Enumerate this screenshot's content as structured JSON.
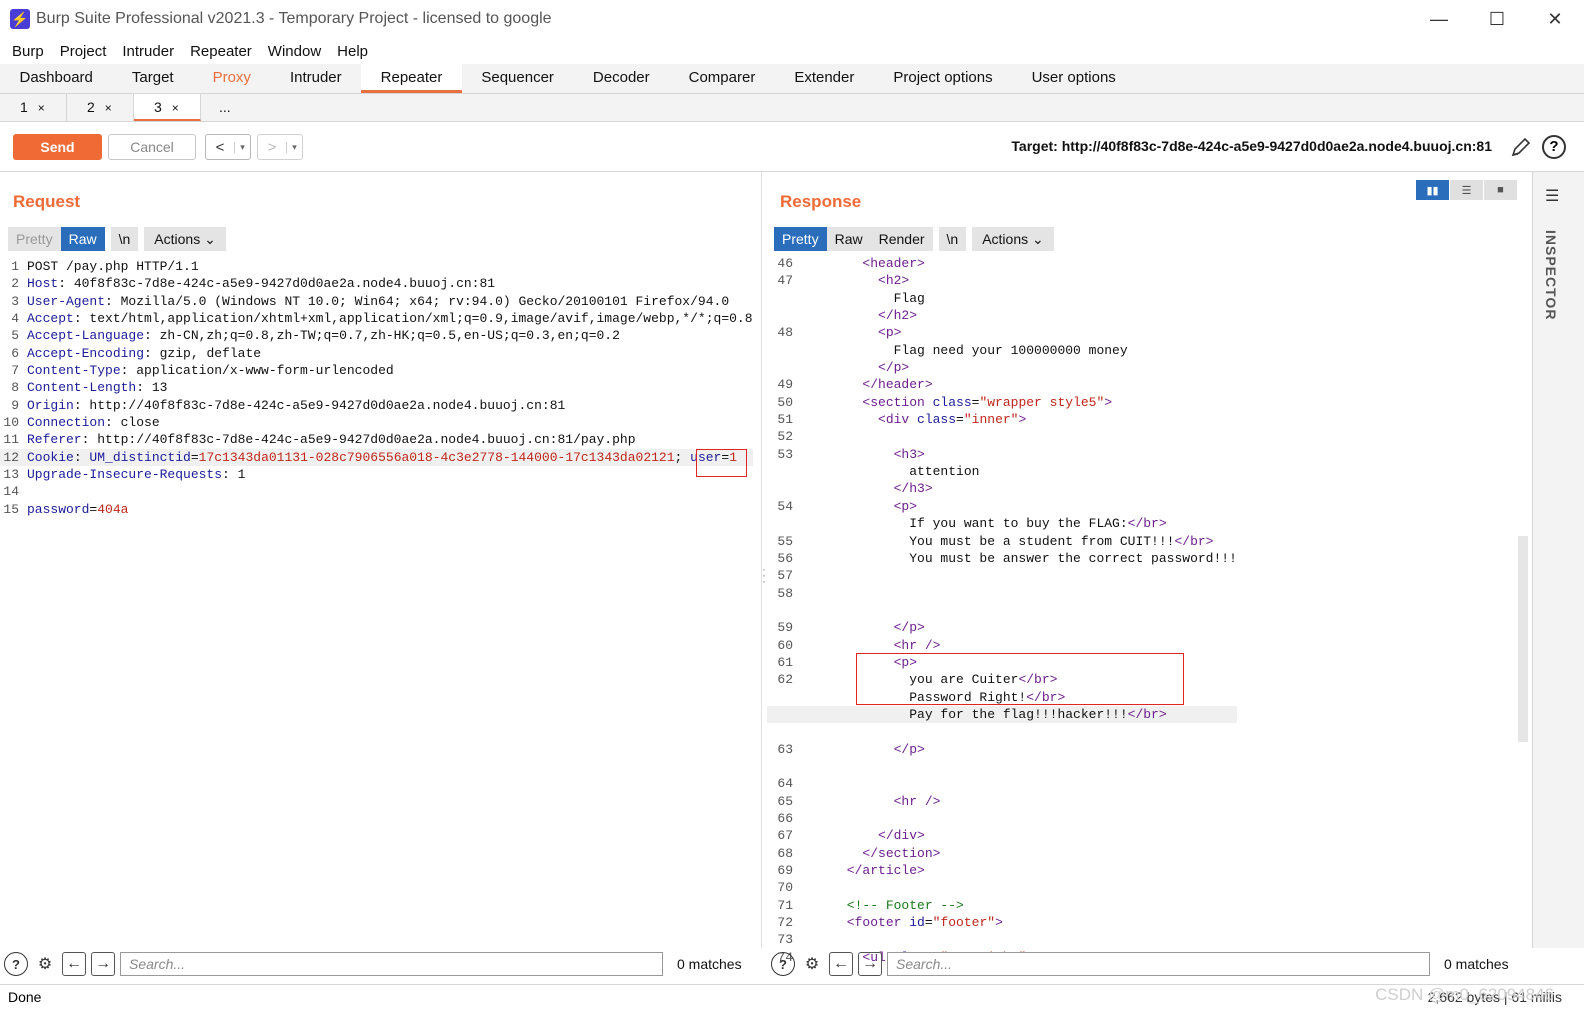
{
  "window": {
    "title": "Burp Suite Professional v2021.3 - Temporary Project - licensed to google",
    "minimize": "—",
    "maximize": "☐",
    "close": "✕"
  },
  "menu": [
    "Burp",
    "Project",
    "Intruder",
    "Repeater",
    "Window",
    "Help"
  ],
  "main_tabs": [
    "Dashboard",
    "Target",
    "Proxy",
    "Intruder",
    "Repeater",
    "Sequencer",
    "Decoder",
    "Comparer",
    "Extender",
    "Project options",
    "User options"
  ],
  "sub_tabs": [
    {
      "label": "1",
      "close": "×"
    },
    {
      "label": "2",
      "close": "×"
    },
    {
      "label": "3",
      "close": "×"
    },
    {
      "label": "..."
    }
  ],
  "toolbar": {
    "send": "Send",
    "cancel": "Cancel",
    "back": "<",
    "forward": ">",
    "dropdown": "▾",
    "target": "Target: http://40f8f83c-7d8e-424c-a5e9-9427d0d0ae2a.node4.buuoj.cn:81",
    "help": "?"
  },
  "request": {
    "title": "Request",
    "views": [
      "Pretty",
      "Raw",
      "\\n"
    ],
    "actions": "Actions",
    "search_placeholder": "Search...",
    "matches": "0 matches"
  },
  "response": {
    "title": "Response",
    "views": [
      "Pretty",
      "Raw",
      "Render",
      "\\n"
    ],
    "actions": "Actions",
    "search_placeholder": "Search...",
    "matches": "0 matches"
  },
  "inspector": {
    "label": "INSPECTOR"
  },
  "status": {
    "left": "Done",
    "right": "2,662 bytes | 61 millis",
    "watermark": "CSDN @m0_62094846"
  },
  "request_lines": [
    {
      "n": "1",
      "parts": [
        {
          "t": "POST /pay.php HTTP/1.1",
          "c": "hv"
        }
      ]
    },
    {
      "n": "2",
      "parts": [
        {
          "t": "Host",
          "c": "hk"
        },
        {
          "t": ": 40f8f83c-7d8e-424c-a5e9-9427d0d0ae2a.node4.buuoj.cn:81",
          "c": "hv"
        }
      ]
    },
    {
      "n": "3",
      "parts": [
        {
          "t": "User-Agent",
          "c": "hk"
        },
        {
          "t": ": Mozilla/5.0 (Windows NT 10.0; Win64; x64; rv:94.0) Gecko/20100101 Firefox/94.0",
          "c": "hv"
        }
      ]
    },
    {
      "n": "4",
      "parts": [
        {
          "t": "Accept",
          "c": "hk"
        },
        {
          "t": ": text/html,application/xhtml+xml,application/xml;q=0.9,image/avif,image/webp,*/*;q=0.8",
          "c": "hv"
        }
      ]
    },
    {
      "n": "5",
      "parts": [
        {
          "t": "Accept-Language",
          "c": "hk"
        },
        {
          "t": ": zh-CN,zh;q=0.8,zh-TW;q=0.7,zh-HK;q=0.5,en-US;q=0.3,en;q=0.2",
          "c": "hv"
        }
      ]
    },
    {
      "n": "6",
      "parts": [
        {
          "t": "Accept-Encoding",
          "c": "hk"
        },
        {
          "t": ": gzip, deflate",
          "c": "hv"
        }
      ]
    },
    {
      "n": "7",
      "parts": [
        {
          "t": "Content-Type",
          "c": "hk"
        },
        {
          "t": ": application/x-www-form-urlencoded",
          "c": "hv"
        }
      ]
    },
    {
      "n": "8",
      "parts": [
        {
          "t": "Content-Length",
          "c": "hk"
        },
        {
          "t": ": 13",
          "c": "hv"
        }
      ]
    },
    {
      "n": "9",
      "parts": [
        {
          "t": "Origin",
          "c": "hk"
        },
        {
          "t": ": http://40f8f83c-7d8e-424c-a5e9-9427d0d0ae2a.node4.buuoj.cn:81",
          "c": "hv"
        }
      ]
    },
    {
      "n": "10",
      "parts": [
        {
          "t": "Connection",
          "c": "hk"
        },
        {
          "t": ": close",
          "c": "hv"
        }
      ]
    },
    {
      "n": "11",
      "parts": [
        {
          "t": "Referer",
          "c": "hk"
        },
        {
          "t": ": http://40f8f83c-7d8e-424c-a5e9-9427d0d0ae2a.node4.buuoj.cn:81/pay.php",
          "c": "hv"
        }
      ]
    },
    {
      "n": "12",
      "hl": true,
      "parts": [
        {
          "t": "Cookie",
          "c": "hk"
        },
        {
          "t": ": ",
          "c": "hv"
        },
        {
          "t": "UM_distinctid",
          "c": "ck"
        },
        {
          "t": "=",
          "c": "hv"
        },
        {
          "t": "17c1343da01131-028c7906556a018-4c3e2778-144000-17c1343da02121",
          "c": "cv"
        },
        {
          "t": "; ",
          "c": "hv"
        },
        {
          "t": "user",
          "c": "ck"
        },
        {
          "t": "=",
          "c": "hv"
        },
        {
          "t": "1",
          "c": "cv"
        }
      ]
    },
    {
      "n": "13",
      "parts": [
        {
          "t": "Upgrade-Insecure-Requests",
          "c": "hk"
        },
        {
          "t": ": 1",
          "c": "hv"
        }
      ]
    },
    {
      "n": "14",
      "parts": []
    },
    {
      "n": "15",
      "parts": [
        {
          "t": "password",
          "c": "ck"
        },
        {
          "t": "=",
          "c": "hv"
        },
        {
          "t": "404a",
          "c": "cv"
        }
      ]
    }
  ],
  "response_lines": [
    {
      "n": "46",
      "parts": [
        {
          "t": "        <",
          "c": "tag"
        },
        {
          "t": "header",
          "c": "tag"
        },
        {
          "t": ">",
          "c": "tag"
        }
      ]
    },
    {
      "n": "47",
      "parts": [
        {
          "t": "          <h2>",
          "c": "tag"
        }
      ]
    },
    {
      "n": "",
      "parts": [
        {
          "t": "            Flag",
          "c": "hv"
        }
      ]
    },
    {
      "n": "",
      "parts": [
        {
          "t": "          </h2>",
          "c": "tag"
        }
      ]
    },
    {
      "n": "48",
      "parts": [
        {
          "t": "          <p>",
          "c": "tag"
        }
      ]
    },
    {
      "n": "",
      "parts": [
        {
          "t": "            Flag need your 100000000 money",
          "c": "hv"
        }
      ]
    },
    {
      "n": "",
      "parts": [
        {
          "t": "          </p>",
          "c": "tag"
        }
      ]
    },
    {
      "n": "49",
      "parts": [
        {
          "t": "        </header>",
          "c": "tag"
        }
      ]
    },
    {
      "n": "50",
      "parts": [
        {
          "t": "        <section ",
          "c": "tag"
        },
        {
          "t": "class",
          "c": "attr"
        },
        {
          "t": "=",
          "c": "hv"
        },
        {
          "t": "\"wrapper style5\"",
          "c": "aval"
        },
        {
          "t": ">",
          "c": "tag"
        }
      ]
    },
    {
      "n": "51",
      "parts": [
        {
          "t": "          <div ",
          "c": "tag"
        },
        {
          "t": "class",
          "c": "attr"
        },
        {
          "t": "=",
          "c": "hv"
        },
        {
          "t": "\"inner\"",
          "c": "aval"
        },
        {
          "t": ">",
          "c": "tag"
        }
      ]
    },
    {
      "n": "52",
      "parts": []
    },
    {
      "n": "53",
      "parts": [
        {
          "t": "            <h3>",
          "c": "tag"
        }
      ]
    },
    {
      "n": "",
      "parts": [
        {
          "t": "              attention",
          "c": "hv"
        }
      ]
    },
    {
      "n": "",
      "parts": [
        {
          "t": "            </h3>",
          "c": "tag"
        }
      ]
    },
    {
      "n": "54",
      "parts": [
        {
          "t": "            <p>",
          "c": "tag"
        }
      ]
    },
    {
      "n": "",
      "parts": [
        {
          "t": "              If you want to buy the FLAG:",
          "c": "hv"
        },
        {
          "t": "</br>",
          "c": "tag"
        }
      ]
    },
    {
      "n": "55",
      "parts": [
        {
          "t": "              You must be a student from CUIT!!!",
          "c": "hv"
        },
        {
          "t": "</br>",
          "c": "tag"
        }
      ]
    },
    {
      "n": "56",
      "parts": [
        {
          "t": "              You must be answer the correct password!!!",
          "c": "hv"
        }
      ]
    },
    {
      "n": "57",
      "parts": []
    },
    {
      "n": "58",
      "parts": []
    },
    {
      "n": "",
      "parts": []
    },
    {
      "n": "59",
      "parts": [
        {
          "t": "            </p>",
          "c": "tag"
        }
      ]
    },
    {
      "n": "60",
      "parts": [
        {
          "t": "            <hr />",
          "c": "tag"
        }
      ]
    },
    {
      "n": "61",
      "parts": [
        {
          "t": "            <p>",
          "c": "tag"
        }
      ]
    },
    {
      "n": "62",
      "parts": [
        {
          "t": "              you are Cuiter",
          "c": "hv"
        },
        {
          "t": "</br>",
          "c": "tag"
        }
      ]
    },
    {
      "n": "",
      "parts": [
        {
          "t": "              Password Right!",
          "c": "hv"
        },
        {
          "t": "</br>",
          "c": "tag"
        }
      ]
    },
    {
      "n": "",
      "hl": true,
      "parts": [
        {
          "t": "              Pay for the flag!!!hacker!!!",
          "c": "hv"
        },
        {
          "t": "</br>",
          "c": "tag"
        }
      ]
    },
    {
      "n": "",
      "parts": []
    },
    {
      "n": "63",
      "parts": [
        {
          "t": "            </p>",
          "c": "tag"
        }
      ]
    },
    {
      "n": "",
      "parts": []
    },
    {
      "n": "64",
      "parts": []
    },
    {
      "n": "65",
      "parts": [
        {
          "t": "            <hr />",
          "c": "tag"
        }
      ]
    },
    {
      "n": "66",
      "parts": []
    },
    {
      "n": "67",
      "parts": [
        {
          "t": "          </div>",
          "c": "tag"
        }
      ]
    },
    {
      "n": "68",
      "parts": [
        {
          "t": "        </section>",
          "c": "tag"
        }
      ]
    },
    {
      "n": "69",
      "parts": [
        {
          "t": "      </article>",
          "c": "tag"
        }
      ]
    },
    {
      "n": "70",
      "parts": []
    },
    {
      "n": "71",
      "parts": [
        {
          "t": "      <!-- Footer -->",
          "c": "cmt"
        }
      ]
    },
    {
      "n": "72",
      "parts": [
        {
          "t": "      <footer ",
          "c": "tag"
        },
        {
          "t": "id",
          "c": "attr"
        },
        {
          "t": "=",
          "c": "hv"
        },
        {
          "t": "\"footer\"",
          "c": "aval"
        },
        {
          "t": ">",
          "c": "tag"
        }
      ]
    },
    {
      "n": "73",
      "parts": []
    },
    {
      "n": "74",
      "parts": [
        {
          "t": "        <ul ",
          "c": "tag"
        },
        {
          "t": "class",
          "c": "attr"
        },
        {
          "t": "=",
          "c": "hv"
        },
        {
          "t": "\"copyright\"",
          "c": "aval"
        },
        {
          "t": ">",
          "c": "tag"
        }
      ]
    }
  ]
}
